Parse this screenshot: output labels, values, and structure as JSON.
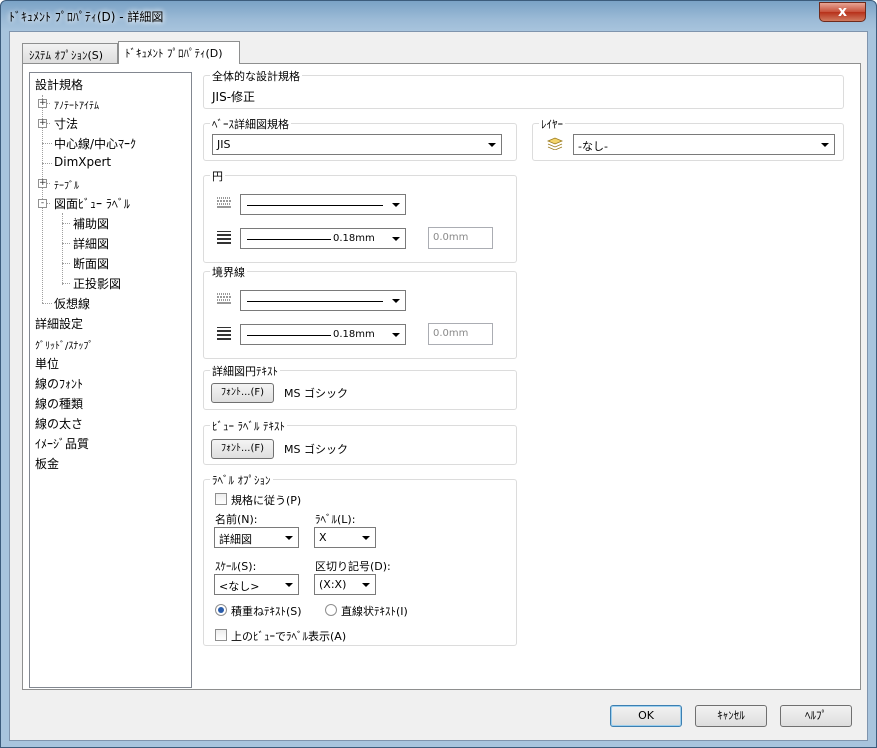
{
  "window": {
    "title": "ﾄﾞｷｭﾒﾝﾄ ﾌﾟﾛﾊﾟﾃｨ(D) - 詳細図",
    "close": "x"
  },
  "tabs": [
    {
      "label": "ｼｽﾃﾑ ｵﾌﾟｼｮﾝ(S)"
    },
    {
      "label": "ﾄﾞｷｭﾒﾝﾄ ﾌﾟﾛﾊﾟﾃｨ(D)"
    }
  ],
  "tree": [
    "設計規格",
    "ｱﾉﾃｰﾄｱｲﾃﾑ",
    "寸法",
    "中心線/中心ﾏｰｸ",
    "DimXpert",
    "ﾃｰﾌﾞﾙ",
    "図面ﾋﾞｭｰ ﾗﾍﾞﾙ",
    "補助図",
    "詳細図",
    "断面図",
    "正投影図",
    "仮想線",
    "詳細設定",
    "ｸﾞﾘｯﾄﾞ/ｽﾅｯﾌﾟ",
    "単位",
    "線のﾌｫﾝﾄ",
    "線の種類",
    "線の太さ",
    "ｲﾒｰｼﾞ品質",
    "板金"
  ],
  "overall_standard": {
    "label": "全体的な設計規格",
    "value": "JIS-修正"
  },
  "base_standard": {
    "label": "ﾍﾞｰｽ詳細図規格",
    "value": "JIS"
  },
  "layer": {
    "label": "ﾚｲﾔｰ",
    "value": "-なし-"
  },
  "circle": {
    "label": "円",
    "thickness": "0.18mm",
    "custom": "0.0mm"
  },
  "boundary": {
    "label": "境界線",
    "thickness": "0.18mm",
    "custom": "0.0mm"
  },
  "circle_text": {
    "label": "詳細図円ﾃｷｽﾄ",
    "button": "ﾌｫﾝﾄ...(F)",
    "font": "MS ゴシック"
  },
  "view_label_text": {
    "label": "ﾋﾞｭｰ ﾗﾍﾞﾙ ﾃｷｽﾄ",
    "button": "ﾌｫﾝﾄ...(F)",
    "font": "MS ゴシック"
  },
  "label_options": {
    "label": "ﾗﾍﾞﾙ ｵﾌﾟｼｮﾝ",
    "follow_standard": "規格に従う(P)",
    "name_label": "名前(N):",
    "name_value": "詳細図",
    "label_label": "ﾗﾍﾞﾙ(L):",
    "label_value": "X",
    "scale_label": "ｽｹｰﾙ(S):",
    "scale_value": "<なし>",
    "delim_label": "区切り記号(D):",
    "delim_value": "(X:X)",
    "radio_stacked": "積重ねﾃｷｽﾄ(S)",
    "radio_linear": "直線状ﾃｷｽﾄ(I)",
    "show_above": "上のﾋﾞｭｰでﾗﾍﾞﾙ表示(A)"
  },
  "footer": {
    "ok": "OK",
    "cancel": "ｷｬﾝｾﾙ",
    "help": "ﾍﾙﾌﾟ"
  }
}
